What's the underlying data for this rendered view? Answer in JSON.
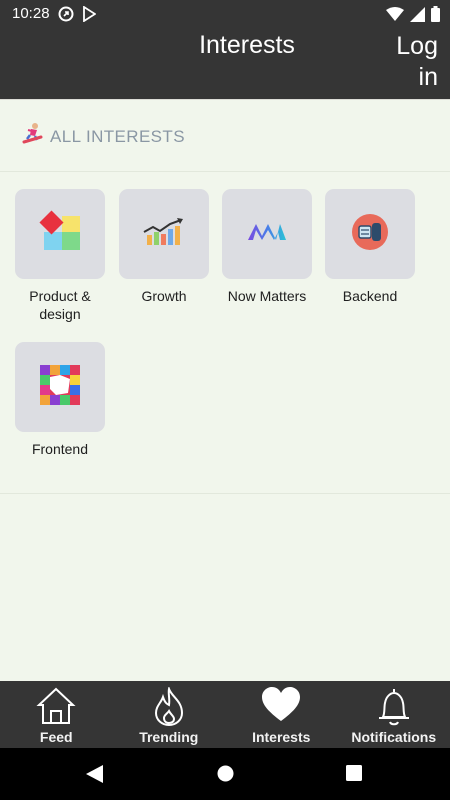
{
  "status_bar": {
    "time": "10:28",
    "icons": [
      "notification-icon",
      "play-store-icon",
      "wifi-icon",
      "signal-icon",
      "battery-icon"
    ]
  },
  "app_bar": {
    "title": "Interests",
    "login_label": "Log in"
  },
  "section": {
    "title": "ALL INTERESTS",
    "icon": "snowboarder-icon"
  },
  "interests": [
    {
      "label": "Product & design",
      "icon": "product-design-icon"
    },
    {
      "label": "Growth",
      "icon": "growth-chart-icon"
    },
    {
      "label": "Now Matters",
      "icon": "now-matters-icon"
    },
    {
      "label": "Backend",
      "icon": "backend-server-icon"
    },
    {
      "label": "Frontend",
      "icon": "frontend-blocks-icon"
    }
  ],
  "bottom_nav": {
    "items": [
      {
        "label": "Feed",
        "icon": "home-icon"
      },
      {
        "label": "Trending",
        "icon": "flame-icon"
      },
      {
        "label": "Interests",
        "icon": "heart-icon",
        "active": true
      },
      {
        "label": "Notifications",
        "icon": "bell-icon"
      }
    ]
  },
  "colors": {
    "bar_background": "#353535",
    "page_background": "#f1f6ec",
    "tile_background": "#dcdde2",
    "section_text": "#8a97a4"
  }
}
